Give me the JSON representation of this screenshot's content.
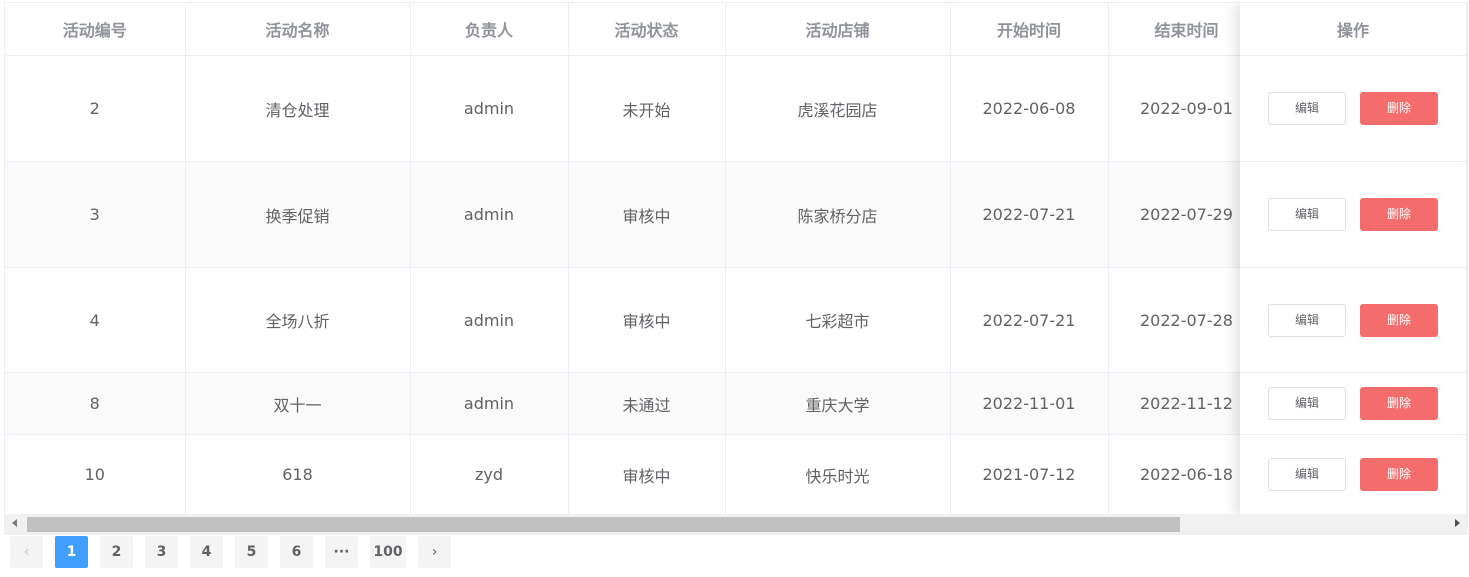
{
  "table": {
    "headers": [
      "活动编号",
      "活动名称",
      "负责人",
      "活动状态",
      "活动店铺",
      "开始时间",
      "结束时间",
      "操作"
    ],
    "rows": [
      {
        "id": "2",
        "name": "清仓处理",
        "owner": "admin",
        "status": "未开始",
        "store": "虎溪花园店",
        "start": "2022-06-08",
        "end": "2022-09-01"
      },
      {
        "id": "3",
        "name": "换季促销",
        "owner": "admin",
        "status": "审核中",
        "store": "陈家桥分店",
        "start": "2022-07-21",
        "end": "2022-07-29"
      },
      {
        "id": "4",
        "name": "全场八折",
        "owner": "admin",
        "status": "审核中",
        "store": "七彩超市",
        "start": "2022-07-21",
        "end": "2022-07-28"
      },
      {
        "id": "8",
        "name": "双十一",
        "owner": "admin",
        "status": "未通过",
        "store": "重庆大学",
        "start": "2022-11-01",
        "end": "2022-11-12"
      },
      {
        "id": "10",
        "name": "618",
        "owner": "zyd",
        "status": "审核中",
        "store": "快乐时光",
        "start": "2021-07-12",
        "end": "2022-06-18"
      }
    ],
    "actions": {
      "edit": "编辑",
      "delete": "删除"
    }
  },
  "pagination": {
    "prev_icon": "‹",
    "next_icon": "›",
    "pages": [
      "1",
      "2",
      "3",
      "4",
      "5",
      "6",
      "···",
      "100"
    ],
    "current": "1"
  },
  "colors": {
    "primary": "#409eff",
    "danger": "#f56c6c",
    "header_text": "#909399",
    "body_text": "#606266",
    "stripe": "#fafafa"
  }
}
